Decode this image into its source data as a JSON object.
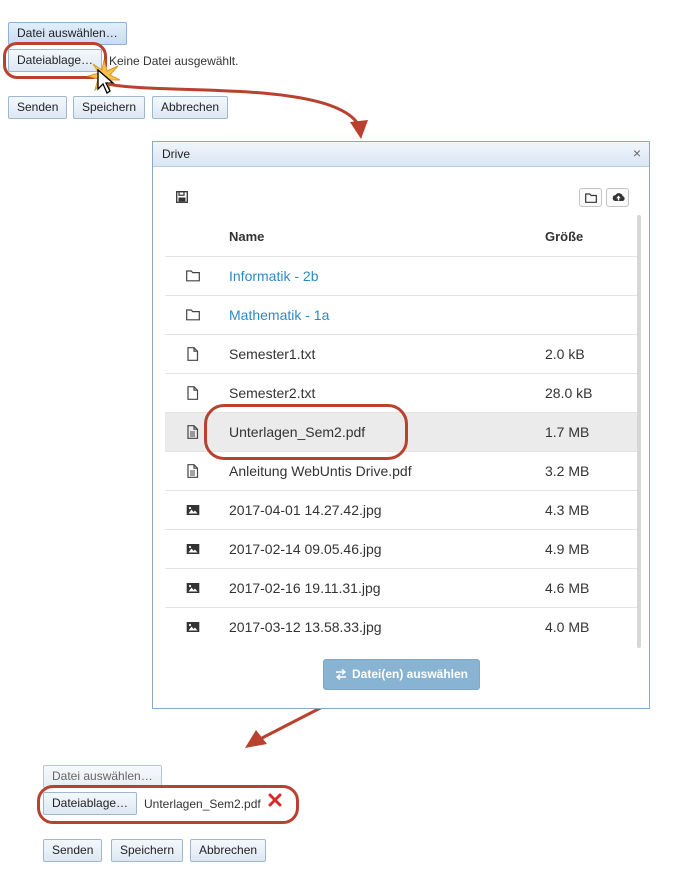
{
  "top_form": {
    "choose_file_label": "Datei auswählen…",
    "storage_label": "Dateiablage…",
    "no_file_text": "Keine Datei ausgewählt.",
    "send_label": "Senden",
    "save_label": "Speichern",
    "cancel_label": "Abbrechen"
  },
  "drive_dialog": {
    "title": "Drive",
    "close_glyph": "×",
    "columns": {
      "name": "Name",
      "size": "Größe"
    },
    "rows": [
      {
        "icon": "folder-icon",
        "name": "Informatik - 2b",
        "size": "",
        "link": true
      },
      {
        "icon": "folder-icon",
        "name": "Mathematik - 1a",
        "size": "",
        "link": true
      },
      {
        "icon": "file-icon",
        "name": "Semester1.txt",
        "size": "2.0 kB"
      },
      {
        "icon": "file-icon",
        "name": "Semester2.txt",
        "size": "28.0 kB"
      },
      {
        "icon": "document-icon",
        "name": "Unterlagen_Sem2.pdf",
        "size": "1.7 MB",
        "selected": true
      },
      {
        "icon": "document-icon",
        "name": "Anleitung WebUntis Drive.pdf",
        "size": "3.2 MB"
      },
      {
        "icon": "image-icon",
        "name": "2017-04-01 14.27.42.jpg",
        "size": "4.3 MB"
      },
      {
        "icon": "image-icon",
        "name": "2017-02-14 09.05.46.jpg",
        "size": "4.9 MB"
      },
      {
        "icon": "image-icon",
        "name": "2017-02-16 19.11.31.jpg",
        "size": "4.6 MB"
      },
      {
        "icon": "image-icon",
        "name": "2017-03-12 13.58.33.jpg",
        "size": "4.0 MB"
      }
    ],
    "select_button_label": "Datei(en) auswählen"
  },
  "bottom_form": {
    "choose_file_label": "Datei auswählen…",
    "storage_label": "Dateiablage…",
    "selected_file": "Unterlagen_Sem2.pdf",
    "send_label": "Senden",
    "save_label": "Speichern",
    "cancel_label": "Abbrechen"
  },
  "colors": {
    "highlight": "#b9412f",
    "link": "#2f8ac4",
    "primary_button": "#89b3d2"
  }
}
